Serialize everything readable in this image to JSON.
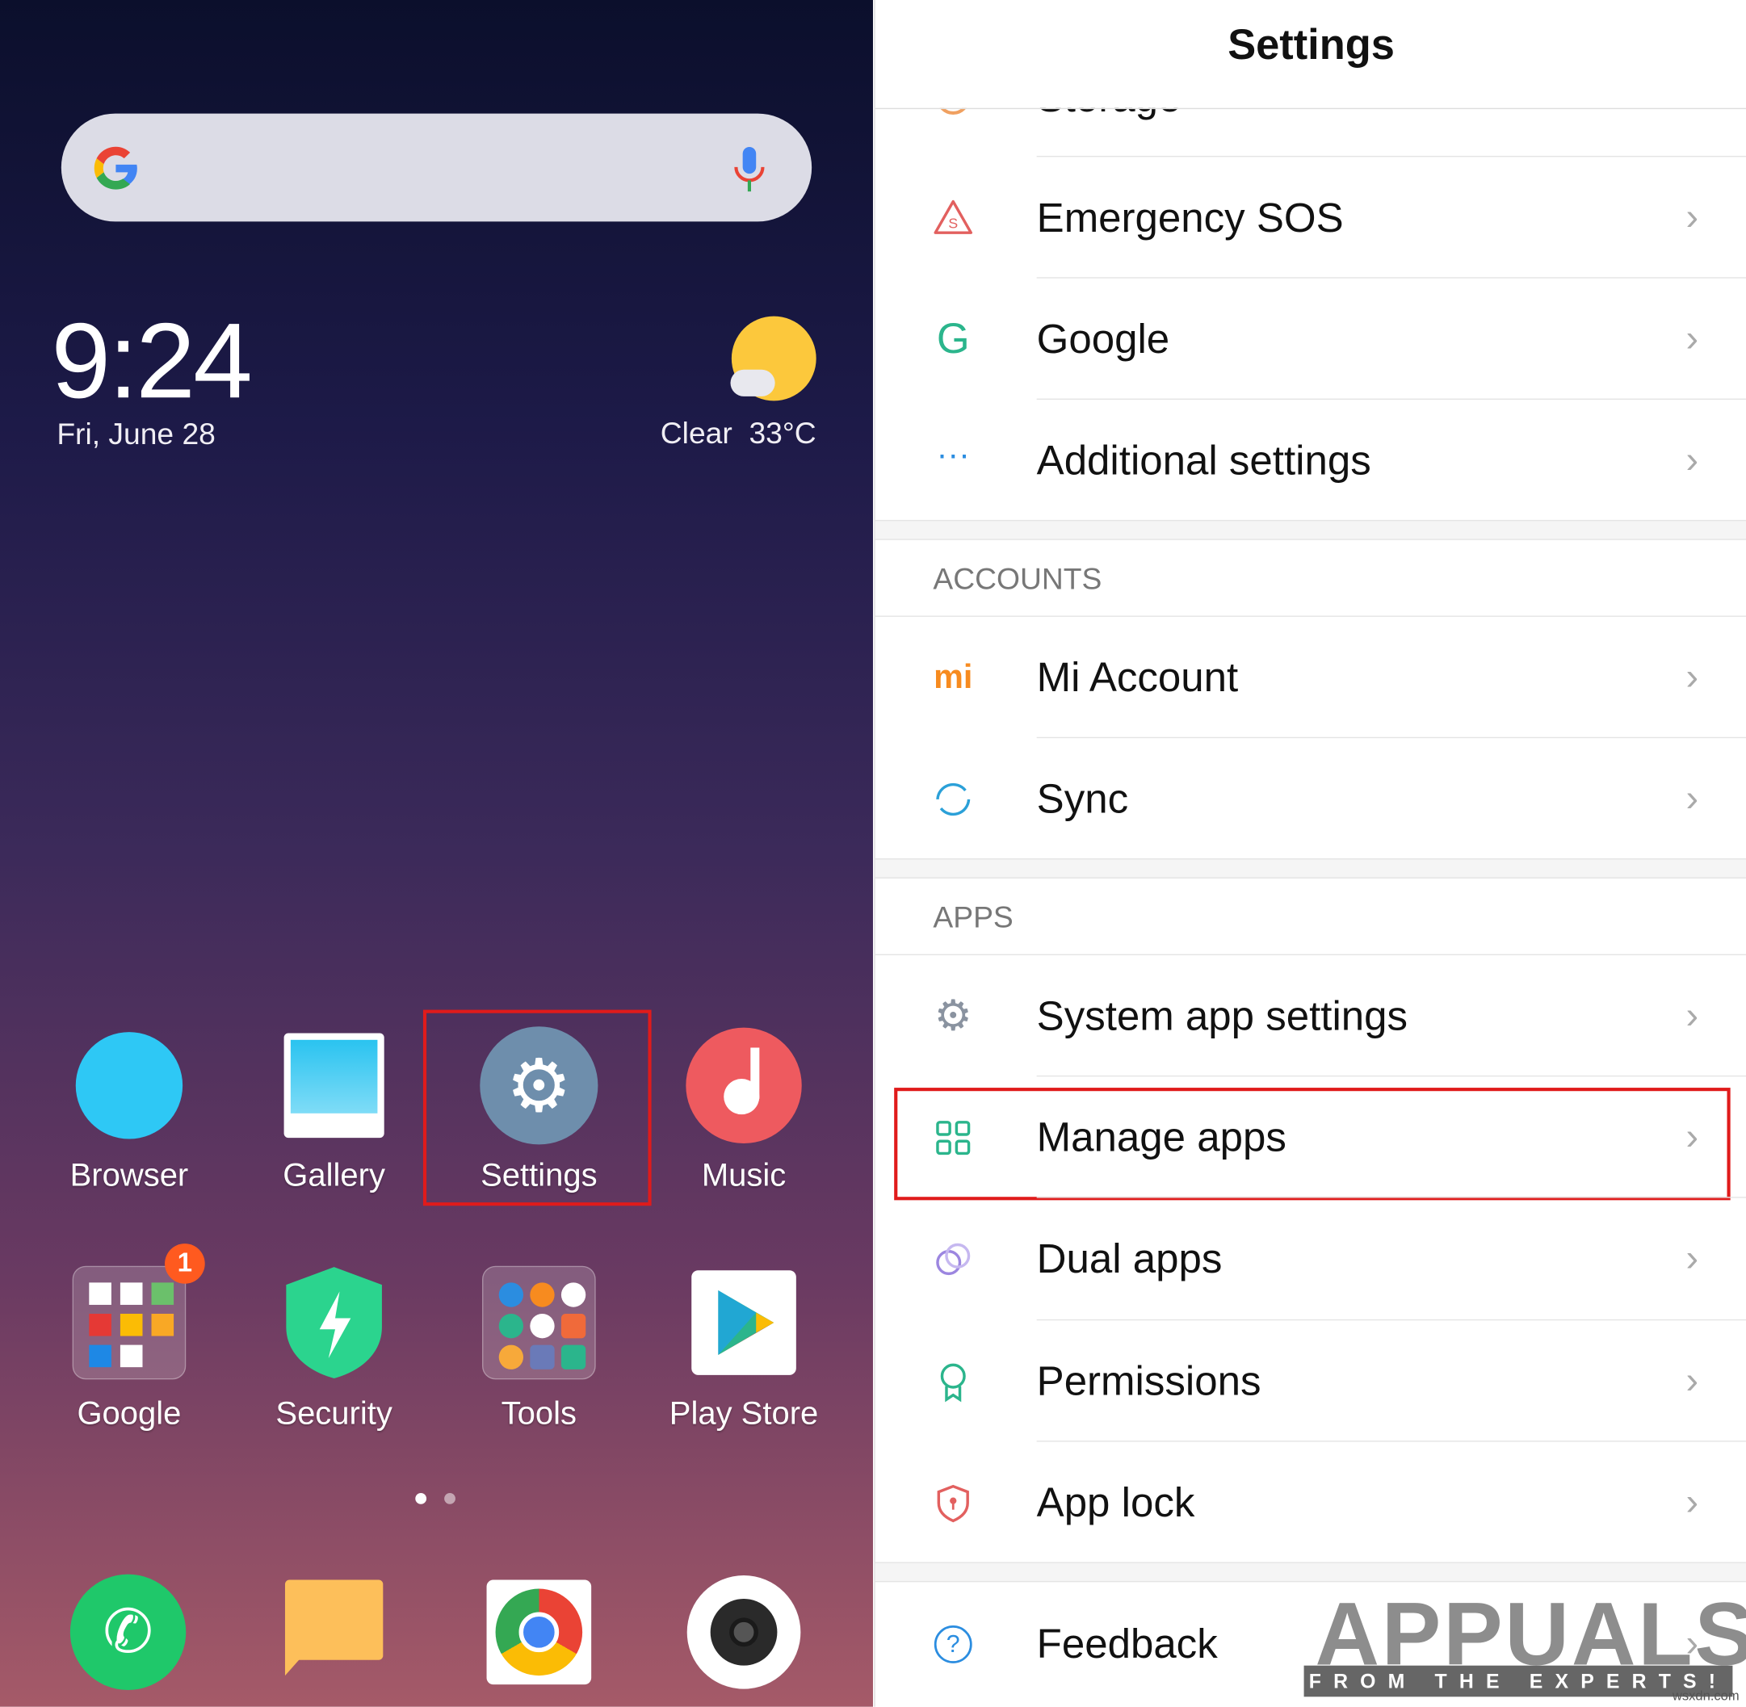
{
  "home": {
    "time": "9:24",
    "date": "Fri, June 28",
    "weather_condition": "Clear",
    "temperature": "33°C",
    "apps": [
      {
        "label": "Browser"
      },
      {
        "label": "Gallery"
      },
      {
        "label": "Settings"
      },
      {
        "label": "Music"
      },
      {
        "label": "Google",
        "badge": "1"
      },
      {
        "label": "Security"
      },
      {
        "label": "Tools"
      },
      {
        "label": "Play Store"
      }
    ],
    "dock": [
      "phone-icon",
      "messages-icon",
      "chrome-icon",
      "camera-icon"
    ],
    "page_indicator": {
      "pages": 2,
      "current": 1
    }
  },
  "settings": {
    "title": "Settings",
    "partial_item": "Storage",
    "items_top": [
      {
        "label": "Emergency SOS",
        "icon": "sos-icon",
        "color": "#e2605f"
      },
      {
        "label": "Google",
        "icon": "google-icon",
        "color": "#2bb58c"
      },
      {
        "label": "Additional settings",
        "icon": "more-dots-icon",
        "color": "#2b8de0"
      }
    ],
    "accounts_header": "ACCOUNTS",
    "accounts": [
      {
        "label": "Mi Account",
        "icon": "mi-icon",
        "color": "#f78b1f"
      },
      {
        "label": "Sync",
        "icon": "sync-icon",
        "color": "#2ba0d8"
      }
    ],
    "apps_header": "APPS",
    "apps": [
      {
        "label": "System app settings",
        "icon": "gear-icon",
        "color": "#8a93a0"
      },
      {
        "label": "Manage apps",
        "icon": "grid-icon",
        "color": "#2bb58c"
      },
      {
        "label": "Dual apps",
        "icon": "dual-circles-icon",
        "color": "#9c86e0"
      },
      {
        "label": "Permissions",
        "icon": "ribbon-icon",
        "color": "#2bb58c"
      },
      {
        "label": "App lock",
        "icon": "shield-lock-icon",
        "color": "#e2605f"
      }
    ],
    "feedback": {
      "label": "Feedback",
      "icon": "help-icon",
      "color": "#2b8de0"
    }
  },
  "watermark": {
    "brand": "APPUALS",
    "tagline": "FROM THE EXPERTS!",
    "site": "wsxdn.com"
  },
  "highlight_color": "#e01b1b"
}
